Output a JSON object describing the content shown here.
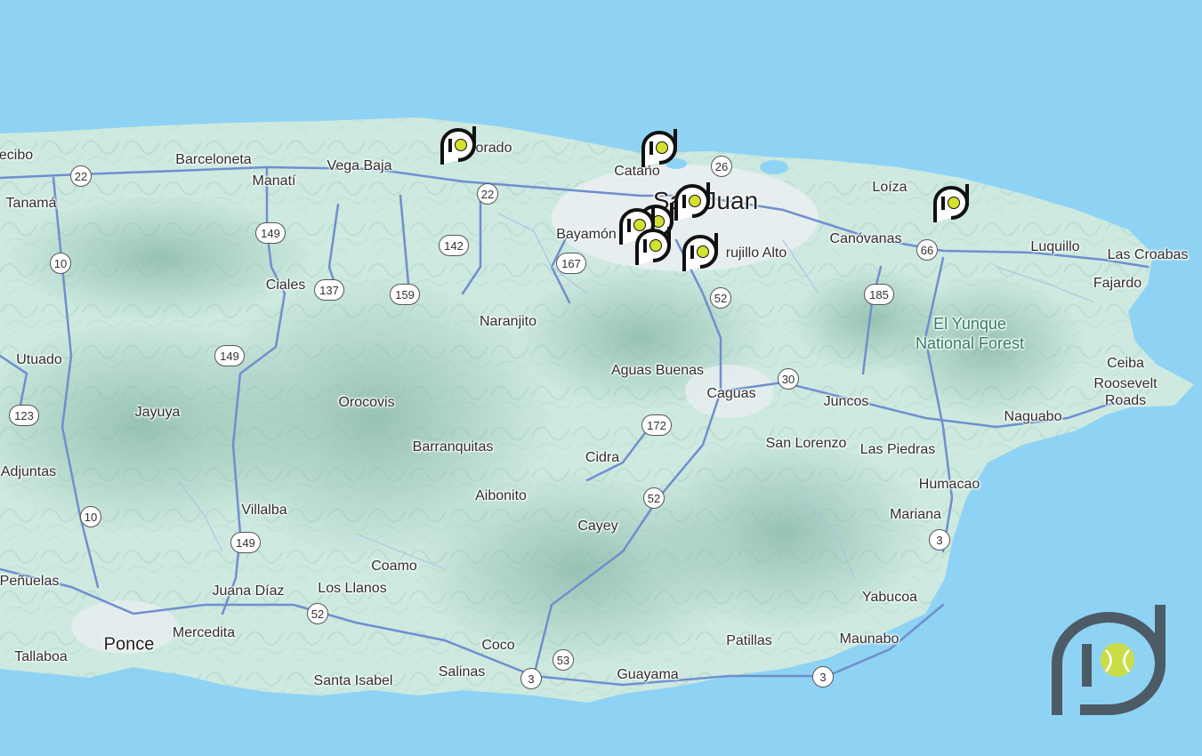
{
  "map": {
    "colors": {
      "water": "#8fd3f4",
      "land": "#cde9e0",
      "urban": "#e9eef1",
      "road": "#6f8fcd",
      "park_label": "#2f7d61"
    },
    "places": {
      "san_juan": "San Juan",
      "barceloneta": "Barceloneta",
      "vega_baja": "Vega Baja",
      "dorado": "orado",
      "catano": "Cataño",
      "arecibo": "ecibo",
      "manati": "Manatí",
      "tanama": "Tanamá",
      "bayamon": "Bayamón",
      "trujillo_alto": "rujillo Alto",
      "loiza": "Loíza",
      "canovanas": "Canóvanas",
      "luquillo": "Luquillo",
      "las_croabas": "Las Croabas",
      "fajardo": "Fajardo",
      "ciales": "Ciales",
      "naranjito": "Naranjito",
      "utuado": "Utuado",
      "el_yunque_line1": "El Yunque",
      "el_yunque_line2": "National Forest",
      "aguas_buenas": "Aguas Buenas",
      "caguas": "Caguas",
      "ceiba": "Ceiba",
      "roosevelt_line1": "Roosevelt",
      "roosevelt_line2": "Roads",
      "jayuya": "Jayuya",
      "orocovis": "Orocovis",
      "juncos": "Juncos",
      "naguabo": "Naguabo",
      "barranquitas": "Barranquitas",
      "san_lorenzo": "San Lorenzo",
      "las_piedras": "Las Piedras",
      "cidra": "Cidra",
      "adjuntas": "Adjuntas",
      "humacao": "Humacao",
      "aibonito": "Aibonito",
      "villalba": "Villalba",
      "mariana": "Mariana",
      "cayey": "Cayey",
      "coamo": "Coamo",
      "penuelas": "Peñuelas",
      "juana_diaz": "Juana Díaz",
      "los_llanos": "Los Llanos",
      "yabucoa": "Yabucoa",
      "ponce": "Ponce",
      "mercedita": "Mercedita",
      "coco": "Coco",
      "patillas": "Patillas",
      "maunabo": "Maunabo",
      "tallaboa": "Tallaboa",
      "salinas": "Salinas",
      "guayama": "Guayama",
      "santa_isabel": "Santa Isabel"
    },
    "routes": {
      "r22a": "22",
      "r22b": "22",
      "r26": "26",
      "r149a": "149",
      "r142": "142",
      "r66": "66",
      "r10a": "10",
      "r137": "137",
      "r159": "159",
      "r167": "167",
      "r52a": "52",
      "r185": "185",
      "r149b": "149",
      "r30": "30",
      "r123": "123",
      "r172": "172",
      "r52b": "52",
      "r10b": "10",
      "r149c": "149",
      "r3a": "3",
      "r52c": "52",
      "r53": "53",
      "r3b": "3",
      "r3c": "3"
    },
    "markers_icon": "pd-tennis-ball-pin-icon",
    "brand_icon": "pd-tennis-ball-logo"
  }
}
